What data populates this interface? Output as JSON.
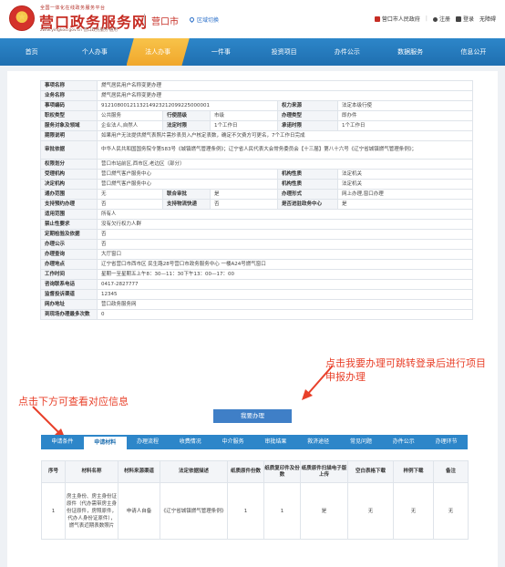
{
  "header": {
    "brand_small": "全国一体化在线政务服务平台",
    "brand": "营口政务服务网",
    "brand_url": "zwfw.yingkou.gov.cn  营口政务服务·通用",
    "city": "营口市",
    "switch_label": "区域切换",
    "gov_link": "营口市人民政府",
    "register": "注册",
    "login": "登录",
    "barrier_free": "无障碍"
  },
  "nav": {
    "items": [
      "首页",
      "个人办事",
      "法人办事",
      "一件事",
      "投资项目",
      "办件公示",
      "数据服务",
      "信息公开"
    ],
    "active_index": 2
  },
  "info": {
    "item_name_k": "事项名称",
    "item_name_v": "燃气居民用户名称变更办理",
    "biz_name_k": "业务名称",
    "biz_name_v": "燃气居民用户名称变更办理",
    "code_k": "事项编码",
    "code_v": "9121080012113214923212099225000001",
    "source_k": "权力来源",
    "source_v": "法定本级行使",
    "duty_k": "职权类型",
    "duty_v": "公共服务",
    "level_k": "行使层级",
    "level_v": "市级",
    "proc_k": "办理类型",
    "proc_v": "即办件",
    "target_k": "服务对象及领域",
    "target_v": "企业法人,自然人",
    "legal_k": "法定时限",
    "legal_v": "1个工作日",
    "promise_k": "承诺时限",
    "promise_v": "1个工作日",
    "period_k": "期限说明",
    "period_v": "如果用户无法提供燃气表照片需抄表员入户核定表数，确定不欠费方可更名，7个工作日完成",
    "basis_k": "审批依据",
    "basis_v": "中华人民共和国国务院令第583号《城镇燃气管理条例》；辽宁省人民代表大会常务委员会【十三届】第八十六号《辽宁省城镇燃气管理条例》；",
    "right_k": "权限划分",
    "right_v": "营口市站前区,西市区,老边区（部分）",
    "accept_k": "受理机构",
    "accept_v": "营口燃气客户服务中心",
    "org1_k": "机构性质",
    "org1_v": "法定机关",
    "decide_k": "决定机构",
    "decide_v": "营口燃气客户服务中心",
    "org2_k": "机构性质",
    "org2_v": "法定机关",
    "pass_k": "通办范围",
    "pass_v": "无",
    "joint_k": "联合审批",
    "joint_v": "是",
    "form_k": "办理形式",
    "form_v": "网上办理,窗口办理",
    "pre_k": "支持预约办理",
    "pre_v": "否",
    "logi_k": "支持物流快递",
    "logi_v": "否",
    "center_k": "是否进驻政务中心",
    "center_v": "是",
    "scope_k": "适用范围",
    "scope_v": "所有人",
    "forbid_k": "禁止性要求",
    "forbid_v": "没有欠行权力人群",
    "check_k": "定期检验及依据",
    "check_v": "否",
    "public_k": "办理公示",
    "public_v": "否",
    "query_k": "办理查询",
    "query_v": "大厅窗口",
    "place_k": "办理地点",
    "place_v": "辽宁省营口市西市区 民生路28号营口市政务服务中心 一楼A24号燃气窗口",
    "time_k": "工作时间",
    "time_v": "星期一至星期五上午8：30—11：30下午13：00—17：00",
    "tel_k": "咨询联系电话",
    "tel_v": "0417-2827777",
    "sup_k": "监督投诉渠道",
    "sup_v": "12345",
    "web_k": "网办地址",
    "web_v": "营口政务服务网",
    "visit_k": "到现场办理最多次数",
    "visit_v": "0"
  },
  "annotations": {
    "right": "点击我要办理可跳转登录后进行项目申报办理",
    "left": "点击下方可查看对应信息"
  },
  "action_button": "我要办理",
  "tabs": {
    "items": [
      "申请条件",
      "申请材料",
      "办理流程",
      "收费情况",
      "中介服务",
      "审批结果",
      "救济途径",
      "常见问题",
      "办件公示",
      "办理环节"
    ],
    "active_index": 1
  },
  "materials": {
    "headers": [
      "序号",
      "材料名称",
      "材料来源渠道",
      "法定依据描述",
      "纸质原件份数",
      "纸质复印件及份数",
      "纸质原件扫描电子版上传",
      "空白表格下载",
      "样例下载",
      "备注"
    ],
    "rows": [
      [
        "1",
        "房主身份、房主身份证原件（代办需带房主身份证原件，房照原件，代办人身份证原件），燃气表近期表数照片",
        "申请人自备",
        "《辽宁省城镇燃气管理条例》",
        "1",
        "1",
        "是",
        "无",
        "无",
        "无"
      ]
    ]
  },
  "colors": {
    "brand_red": "#c62d24",
    "nav_blue": "#2d86c9",
    "active_orange": "#f0a72c",
    "annotation_red": "#e8402a"
  }
}
